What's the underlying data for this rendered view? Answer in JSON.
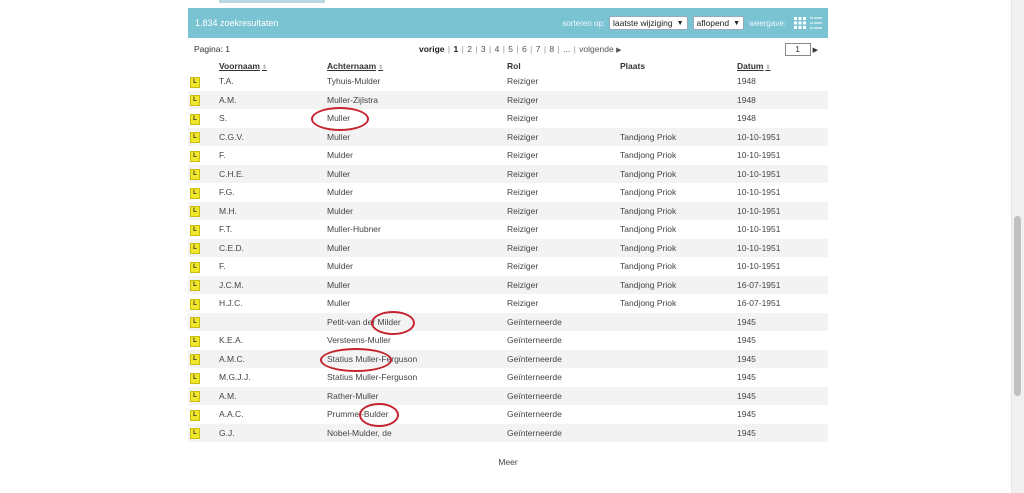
{
  "results": {
    "count_label": "1.834 zoekresultaten",
    "sort_label": "sorteren op:",
    "sort_field": "laatste wijziging",
    "sort_order": "aflopend",
    "view_label": "weergave:",
    "accent": "#79c3d2",
    "circle_color": "#c5232f"
  },
  "pager": {
    "page_label": "Pagina: 1",
    "prev": "vorige",
    "pages": [
      "1",
      "2",
      "3",
      "4",
      "5",
      "6",
      "7",
      "8",
      "..."
    ],
    "next": "volgende",
    "page_input": "1"
  },
  "columns": {
    "type": "",
    "first": "Voornaam",
    "last": "Achternaam",
    "role": "Rol",
    "place": "Plaats",
    "date": "Datum"
  },
  "rows": [
    {
      "type": "L",
      "first": "T.A.",
      "last": "Tyhuis-Mulder",
      "role": "Reiziger",
      "place": "",
      "date": "1948"
    },
    {
      "type": "L",
      "first": "A.M.",
      "last": "Muller-Zijlstra",
      "role": "Reiziger",
      "place": "",
      "date": "1948"
    },
    {
      "type": "L",
      "first": "S.",
      "last": "Muller",
      "role": "Reiziger",
      "place": "",
      "date": "1948",
      "circled": true
    },
    {
      "type": "L",
      "first": "C.G.V.",
      "last": "Muller",
      "role": "Reiziger",
      "place": "Tandjong Priok",
      "date": "10-10-1951"
    },
    {
      "type": "L",
      "first": "F.",
      "last": "Mulder",
      "role": "Reiziger",
      "place": "Tandjong Priok",
      "date": "10-10-1951"
    },
    {
      "type": "L",
      "first": "C.H.E.",
      "last": "Muller",
      "role": "Reiziger",
      "place": "Tandjong Priok",
      "date": "10-10-1951"
    },
    {
      "type": "L",
      "first": "F.G.",
      "last": "Mulder",
      "role": "Reiziger",
      "place": "Tandjong Priok",
      "date": "10-10-1951"
    },
    {
      "type": "L",
      "first": "M.H.",
      "last": "Mulder",
      "role": "Reiziger",
      "place": "Tandjong Priok",
      "date": "10-10-1951"
    },
    {
      "type": "L",
      "first": "F.T.",
      "last": "Muller-Hubner",
      "role": "Reiziger",
      "place": "Tandjong Priok",
      "date": "10-10-1951"
    },
    {
      "type": "L",
      "first": "C.E.D.",
      "last": "Muller",
      "role": "Reiziger",
      "place": "Tandjong Priok",
      "date": "10-10-1951"
    },
    {
      "type": "L",
      "first": "F.",
      "last": "Mulder",
      "role": "Reiziger",
      "place": "Tandjong Priok",
      "date": "10-10-1951"
    },
    {
      "type": "L",
      "first": "J.C.M.",
      "last": "Muller",
      "role": "Reiziger",
      "place": "Tandjong Priok",
      "date": "16-07-1951"
    },
    {
      "type": "L",
      "first": "H.J.C.",
      "last": "Muller",
      "role": "Reiziger",
      "place": "Tandjong Priok",
      "date": "16-07-1951"
    },
    {
      "type": "L",
      "first": "",
      "last": "Petit-van der Milder",
      "role": "Geïnterneerde",
      "place": "",
      "date": "1945",
      "circled": true
    },
    {
      "type": "L",
      "first": "K.E.A.",
      "last": "Versteens-Muller",
      "role": "Geïnterneerde",
      "place": "",
      "date": "1945"
    },
    {
      "type": "L",
      "first": "A.M.C.",
      "last": "Statius Muller-Ferguson",
      "role": "Geïnterneerde",
      "place": "",
      "date": "1945",
      "circled": true
    },
    {
      "type": "L",
      "first": "M.G.J.J.",
      "last": "Statius Muller-Ferguson",
      "role": "Geïnterneerde",
      "place": "",
      "date": "1945"
    },
    {
      "type": "L",
      "first": "A.M.",
      "last": "Rather-Muller",
      "role": "Geïnterneerde",
      "place": "",
      "date": "1945"
    },
    {
      "type": "L",
      "first": "A.A.C.",
      "last": "Prummel-Bulder",
      "role": "Geïnterneerde",
      "place": "",
      "date": "1945",
      "circled": true
    },
    {
      "type": "L",
      "first": "G.J.",
      "last": "Nobel-Mulder, de",
      "role": "Geïnterneerde",
      "place": "",
      "date": "1945"
    }
  ],
  "more_label": "Meer"
}
